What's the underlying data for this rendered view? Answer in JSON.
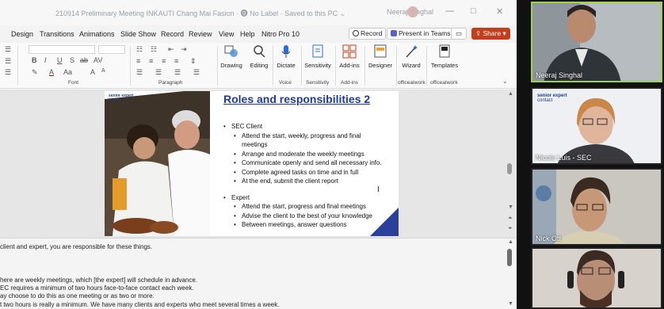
{
  "titlebar": {
    "title": "210914 Preliminary Meeting INKAUTI Chang Mai Fasion · ⓿ No Label · Saved to this PC ⌄",
    "user": "Neeraj Singhal",
    "minimize": "—",
    "restore": "□",
    "close": "✕"
  },
  "tabs": [
    "Design",
    "Transitions",
    "Animations",
    "Slide Show",
    "Record",
    "Review",
    "View",
    "Help",
    "Nitro Pro 10"
  ],
  "toolbar": {
    "record_label": "Record",
    "present_label": "Present in Teams",
    "share_label": "Share"
  },
  "ribbon": {
    "groups": {
      "font": "Font",
      "paragraph": "Paragraph",
      "voice": "Voice",
      "sensitivity": "Sensitivity",
      "addins": "Add-ins",
      "officeatwork1": "officeatwork",
      "officeatwork2": "officeatwork"
    },
    "buttons": {
      "drawing": "Drawing",
      "editing": "Editing",
      "dictate": "Dictate",
      "sensitivity": "Sensitivity",
      "addins": "Add-ins",
      "designer": "Designer",
      "wizard": "Wizard",
      "templates": "Templates"
    },
    "font_glyphs": [
      "B",
      "I",
      "U",
      "S",
      "ab",
      "AV",
      "A",
      "A",
      "Aa",
      "A"
    ]
  },
  "slide": {
    "logo_line1": "senior expert",
    "logo_line2": "contact",
    "title": "Roles and responsibilities 2",
    "bullets": [
      {
        "level": 1,
        "text": "SEC Client"
      },
      {
        "level": 2,
        "text": "Attend the start, weekly, progress and final"
      },
      {
        "level": 2,
        "text": "meetings",
        "cont": true
      },
      {
        "level": 2,
        "text": "Arrange and moderate the weekly meetings"
      },
      {
        "level": 2,
        "text": "Communicate openly and send all necessary info."
      },
      {
        "level": 2,
        "text": "Complete agreed tasks on time and in full"
      },
      {
        "level": 2,
        "text": "At the end, submit the client report"
      },
      {
        "level": 1,
        "text": "Expert"
      },
      {
        "level": 2,
        "text": "Attend the start, progress and final meetings"
      },
      {
        "level": 2,
        "text": "Advise the client to the best of your knowledge"
      },
      {
        "level": 2,
        "text": "Between meetings, answer questions"
      }
    ]
  },
  "notes": [
    "client and expert, you are responsible for these things.",
    "here are weekly meetings, which [the expert] will schedule in advance.",
    "EC requires a minimum of two hours face-to-face contact each week.",
    "ay choose to do this as one meeting or as two or more.",
    "t two hours is really a minimum. We have many clients and experts who meet several times a week."
  ],
  "participants": [
    {
      "name": "Neeraj Singhal"
    },
    {
      "name": "Nicole Luis - SEC",
      "logo_line1": "senior expert",
      "logo_line2": "contact"
    },
    {
      "name": "Nick Ott"
    },
    {
      "name": ""
    }
  ],
  "colors": {
    "slide_title": "#1f3b9a",
    "share": "#c43e1c",
    "active_speaker": "#9fd14b"
  }
}
